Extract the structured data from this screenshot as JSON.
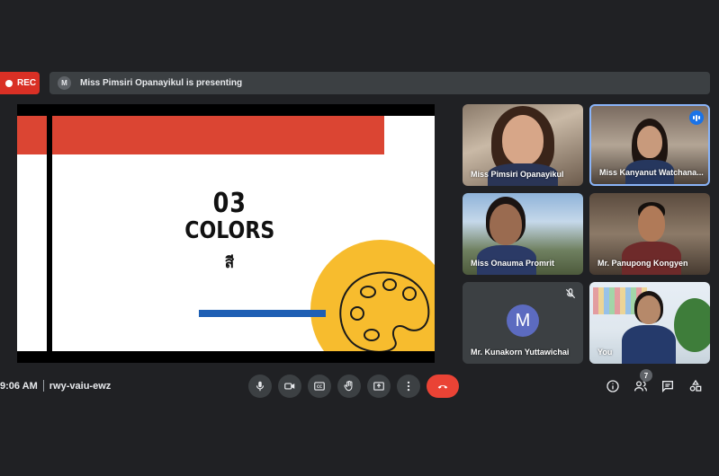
{
  "recording": {
    "label": "REC"
  },
  "presenting": {
    "avatar_letter": "M",
    "text": "Miss Pimsiri Opanayikul is presenting"
  },
  "slide": {
    "number": "03",
    "title": "COLORS",
    "subtitle_thai": "สี"
  },
  "participants": [
    {
      "name": "Miss Pimsiri Opanayikul"
    },
    {
      "name": "Miss Kanyanut Watchana..."
    },
    {
      "name": "Miss Onauma Promrit"
    },
    {
      "name": "Mr. Panupong Kongyen"
    },
    {
      "name": "Mr. Kunakorn Yuttawichai",
      "avatar_letter": "M"
    },
    {
      "name": "You"
    }
  ],
  "bottom_bar": {
    "time": "9:06 AM",
    "meeting_code": "rwy-vaiu-ewz",
    "participant_count": "7"
  },
  "colors": {
    "background": "#202124",
    "rec_red": "#d93025",
    "end_call_red": "#ea4335",
    "active_speaker_blue": "#8ab4f8",
    "avatar_purple": "#5c6bc0"
  },
  "icons": {
    "controls": [
      "microphone-icon",
      "camera-icon",
      "captions-icon",
      "raise-hand-icon",
      "present-screen-icon",
      "more-options-icon",
      "end-call-icon"
    ],
    "right": [
      "info-icon",
      "people-icon",
      "chat-icon",
      "activities-icon"
    ]
  }
}
